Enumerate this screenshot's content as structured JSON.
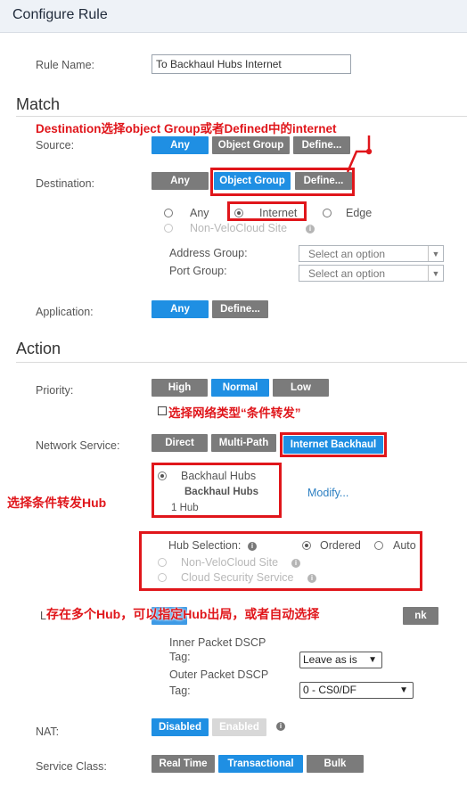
{
  "header": {
    "title": "Configure Rule"
  },
  "rule_name": {
    "label": "Rule Name:",
    "value": "To Backhaul Hubs Internet"
  },
  "match": {
    "title": "Match",
    "source": {
      "label": "Source:",
      "buttons": [
        "Any",
        "Object Group",
        "Define..."
      ]
    },
    "destination": {
      "label": "Destination:",
      "buttons": [
        "Any",
        "Object Group",
        "Define..."
      ],
      "options": {
        "any": "Any",
        "internet": "Internet",
        "edge": "Edge",
        "non_velocloud": "Non-VeloCloud Site"
      },
      "address_group": {
        "label": "Address Group:",
        "placeholder": "Select an option"
      },
      "port_group": {
        "label": "Port Group:",
        "placeholder": "Select an option"
      }
    },
    "application": {
      "label": "Application:",
      "buttons": [
        "Any",
        "Define..."
      ]
    }
  },
  "action": {
    "title": "Action",
    "priority": {
      "label": "Priority:",
      "buttons": [
        "High",
        "Normal",
        "Low"
      ]
    },
    "network_service": {
      "label": "Network Service:",
      "buttons": [
        "Direct",
        "Multi-Path",
        "Internet Backhaul"
      ],
      "backhaul_hubs": {
        "option": "Backhaul Hubs",
        "name": "Backhaul Hubs",
        "count": "1 Hub",
        "modify": "Modify..."
      },
      "hub_selection": {
        "label": "Hub Selection:",
        "ordered": "Ordered",
        "auto": "Auto"
      },
      "non_velocloud": "Non-VeloCloud Site",
      "cloud_security": "Cloud Security Service"
    },
    "link_partial": {
      "label_char": "L",
      "button_tail": "nk"
    },
    "inner_dscp": {
      "label_line1": "Inner Packet DSCP",
      "label_line2": "Tag:",
      "value": "Leave as is"
    },
    "outer_dscp": {
      "label_line1": "Outer Packet DSCP",
      "label_line2": "Tag:",
      "value": "0 - CS0/DF"
    },
    "nat": {
      "label": "NAT:",
      "buttons": [
        "Disabled",
        "Enabled"
      ]
    },
    "service_class": {
      "label": "Service Class:",
      "buttons": [
        "Real Time",
        "Transactional",
        "Bulk"
      ]
    }
  },
  "annotations": {
    "destination_note": "Destination选择object Group或者Defined中的internet",
    "network_type_note": "选择网络类型“条件转发”",
    "hub_note": "选择条件转发Hub",
    "multi_hub_note": "存在多个Hub，可以指定Hub出局，或者自动选择"
  },
  "colors": {
    "accent": "#1f8fe3",
    "gray_button": "#7b7b7b",
    "annotation": "#e0161b"
  },
  "icons": {
    "info": "info-icon",
    "radio": "radio-icon",
    "dropdown_arrow": "chevron-down-icon",
    "checkbox": "checkbox-icon"
  }
}
